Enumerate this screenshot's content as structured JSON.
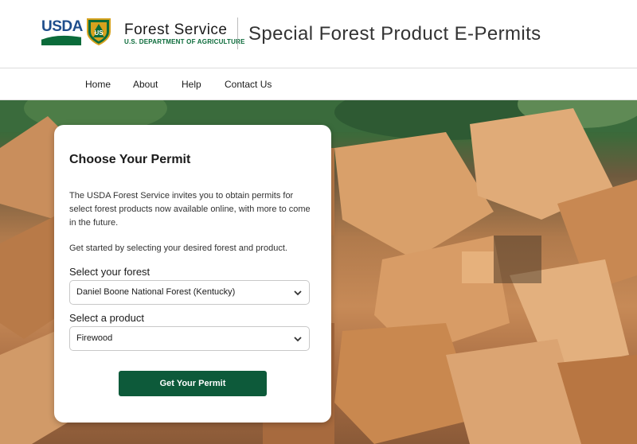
{
  "header": {
    "usda_logo_text": "USDA",
    "fs_shield_text": "US",
    "agency_title": "Forest Service",
    "agency_subtitle": "U.S. DEPARTMENT OF AGRICULTURE",
    "app_title": "Special Forest Product E-Permits"
  },
  "nav": {
    "items": [
      {
        "label": "Home"
      },
      {
        "label": "About"
      },
      {
        "label": "Help"
      },
      {
        "label": "Contact Us"
      }
    ]
  },
  "card": {
    "title": "Choose Your Permit",
    "description": "The USDA Forest Service invites you to obtain permits for select forest products now available online, with more to come in the future.",
    "get_started": "Get started by selecting your desired forest and product.",
    "forest_label": "Select your forest",
    "forest_value": "Daniel Boone National Forest (Kentucky)",
    "product_label": "Select a product",
    "product_value": "Firewood",
    "button_label": "Get Your Permit"
  },
  "colors": {
    "brand_green": "#0d5a3a",
    "usda_blue": "#1f4e8c"
  },
  "icons": {
    "select_chevron": "chevron-down-icon"
  }
}
